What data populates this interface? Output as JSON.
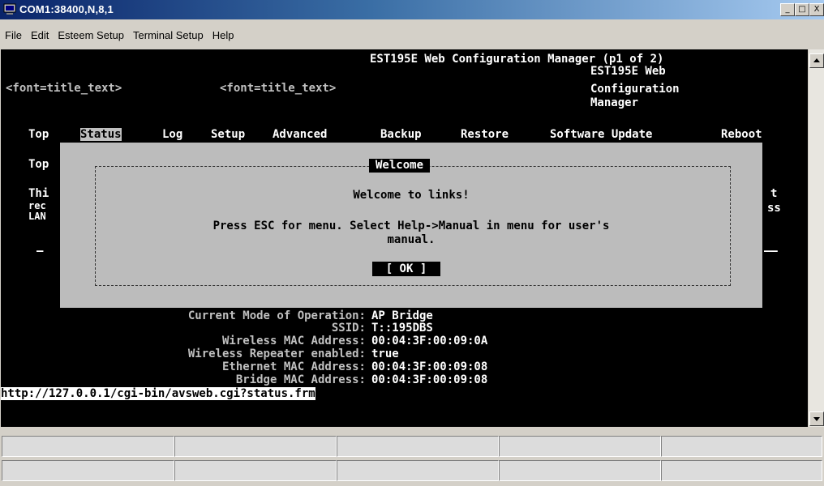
{
  "window": {
    "title": "COM1:38400,N,8,1",
    "buttons": {
      "minimize": "_",
      "maximize": "□",
      "close": "X"
    }
  },
  "menu": [
    "File",
    "Edit",
    "Esteem Setup",
    "Terminal Setup",
    "Help"
  ],
  "terminal": {
    "header": "EST195E Web Configuration Manager (p1 of 2)",
    "title_tag_1": "<font=title_text>",
    "title_tag_2": "<font=title_text>",
    "side_title": [
      "EST195E Web",
      "Configuration",
      "Manager"
    ],
    "nav": [
      "Top",
      "Status",
      "Log",
      "Setup",
      "Advanced",
      "Backup",
      "Restore",
      "Software Update",
      "Reboot"
    ],
    "nav_selected": "Status",
    "hidden_left": {
      "line1": "Top",
      "line2": "Thi",
      "line3": "rec",
      "line4": "LAN",
      "dash": "–"
    },
    "hidden_right": {
      "line2": "t",
      "line3": "ss",
      "dash": "——"
    },
    "status_fields": [
      {
        "label": "Current Mode of Operation:",
        "value": "AP Bridge"
      },
      {
        "label": "SSID:",
        "value": "T::195DBS"
      },
      {
        "label": "Wireless MAC Address:",
        "value": "00:04:3F:00:09:0A"
      },
      {
        "label": "Wireless Repeater enabled:",
        "value": "true"
      },
      {
        "label": "Ethernet MAC Address:",
        "value": "00:04:3F:00:09:08"
      },
      {
        "label": "Bridge MAC Address:",
        "value": "00:04:3F:00:09:08"
      }
    ],
    "url": "http://127.0.0.1/cgi-bin/avsweb.cgi?status.frm"
  },
  "dialog": {
    "title": "Welcome",
    "line1": "Welcome to links!",
    "line2": "Press ESC for menu. Select Help->Manual in menu for user's",
    "line3": "manual.",
    "ok_label": "[ OK ]"
  },
  "colors": {
    "titlebar_start": "#0a246a",
    "titlebar_end": "#a6caf0",
    "terminal_bg": "#000000",
    "dialog_bg": "#bcbcbc"
  }
}
